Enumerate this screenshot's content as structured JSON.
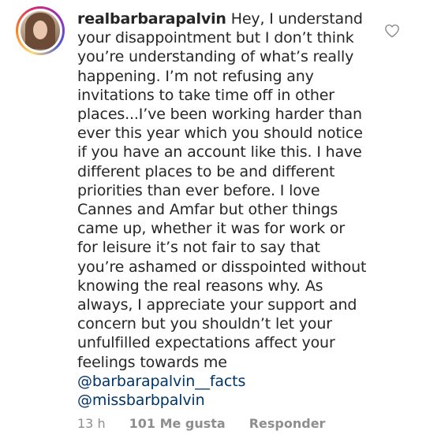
{
  "comment": {
    "username": "realbarbarapalvin",
    "text": "Hey, I understand your disappointment but I don’t think you’re understanding of what’s really happening. I’m not refusing any invitations to take time off in other places...I’ve been working harder than ever this year which you should notice if you have an account like this. I have different places to be and different priorities than ever before. I love Cannes and Amfar but other things came up, whether it was for work or for leisure it’s not fair to say that you’re ashamed or disspointed without knowing the real reasons why. As always, I appreciate your support and concern but you shouldn’t let your unfulfilled expectations affect your feelings towards me",
    "mentions": [
      "@barbarapalvin__facts",
      "@missbarbpalvin"
    ],
    "time": "13 h",
    "likes": "101 Me gusta",
    "reply_label": "Responder"
  },
  "icons": {
    "like": "heart-outline-icon",
    "avatar": "profile-avatar"
  },
  "colors": {
    "text": "#262626",
    "meta": "#8e8e8e",
    "mention": "#003569",
    "background": "#ffffff"
  }
}
